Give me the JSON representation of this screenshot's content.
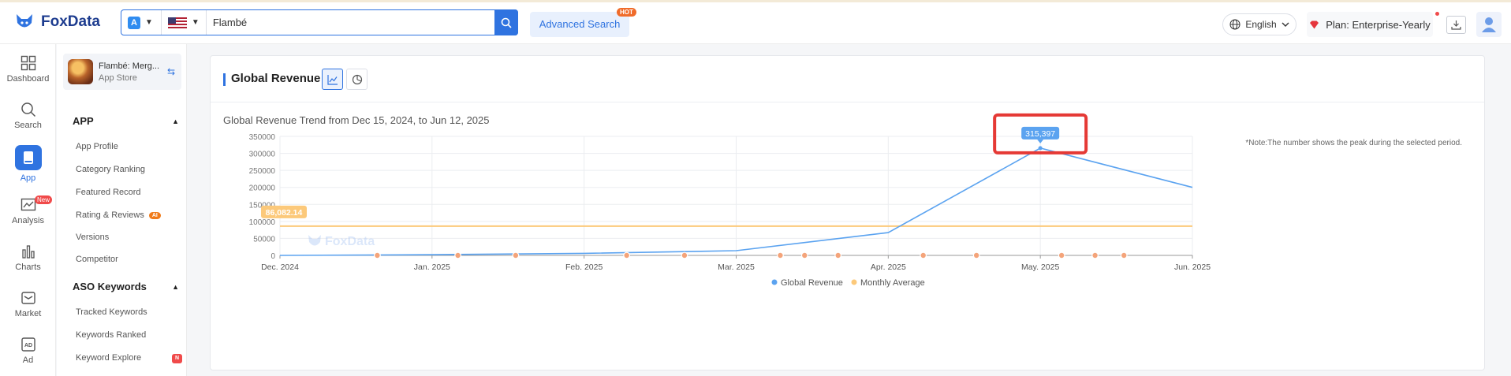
{
  "header": {
    "logo_text": "FoxData",
    "search_value": "Flambé",
    "advanced_search": "Advanced Search",
    "hot_badge": "HOT",
    "language": "English",
    "plan": "Plan: Enterprise-Yearly"
  },
  "leftnav": [
    {
      "label": "Dashboard",
      "icon": "grid-icon"
    },
    {
      "label": "Search",
      "icon": "search-icon"
    },
    {
      "label": "App",
      "icon": "app-icon",
      "active": true
    },
    {
      "label": "Analysis",
      "icon": "analysis-icon",
      "badge": "New"
    },
    {
      "label": "Charts",
      "icon": "bar-chart-icon"
    },
    {
      "label": "Market",
      "icon": "market-icon"
    },
    {
      "label": "Ad",
      "icon": "ad-icon"
    }
  ],
  "app_card": {
    "name": "Flambé: Merg...",
    "store": "App Store"
  },
  "subnav": {
    "app_section": "APP",
    "app_items": [
      "App Profile",
      "Category Ranking",
      "Featured Record",
      "Rating & Reviews",
      "Versions",
      "Competitor"
    ],
    "ai_badge": "AI",
    "aso_section": "ASO Keywords",
    "aso_items": [
      "Tracked Keywords",
      "Keywords Ranked",
      "Keyword Explore"
    ],
    "n_badge": "N"
  },
  "panel": {
    "title": "Global Revenue",
    "trend_title": "Global Revenue Trend from Dec 15, 2024, to Jun 12, 2025",
    "note": "*Note:The number shows the peak during the selected period.",
    "watermark": "FoxData"
  },
  "chart_data": {
    "type": "line",
    "y_ticks": [
      "350000",
      "300000",
      "250000",
      "200000",
      "150000",
      "100000",
      "50000",
      "0"
    ],
    "ylim": [
      0,
      350000
    ],
    "x_ticks": [
      "Dec. 2024",
      "Jan. 2025",
      "Feb. 2025",
      "Mar. 2025",
      "Apr. 2025",
      "May. 2025",
      "Jun. 2025"
    ],
    "series": [
      {
        "name": "Global Revenue",
        "color": "#5ba3f0",
        "points": [
          [
            0,
            0
          ],
          [
            1,
            2000
          ],
          [
            2,
            6000
          ],
          [
            3,
            14000
          ],
          [
            4,
            67000
          ],
          [
            5,
            315397
          ],
          [
            6,
            200000
          ]
        ]
      },
      {
        "name": "Monthly Average",
        "color": "#fcc97a",
        "constant": 86082.14
      }
    ],
    "peak_label": "315,397",
    "average_label": "86,082.14",
    "event_markers_x": [
      0.64,
      1.17,
      1.55,
      2.28,
      2.66,
      3.29,
      3.45,
      3.67,
      4.23,
      4.58,
      5.14,
      5.36,
      5.55
    ],
    "legend": "bottom-center",
    "highlight_color": "#e53935"
  }
}
